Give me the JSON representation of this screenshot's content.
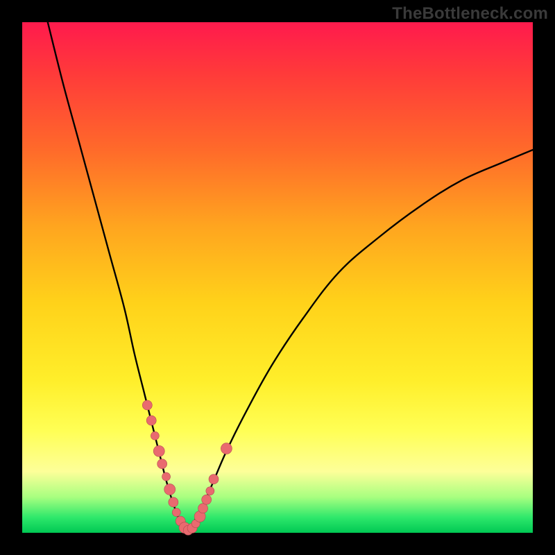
{
  "watermark": "TheBottleneck.com",
  "colors": {
    "frame": "#000000",
    "curve": "#000000",
    "marker_fill": "#e96a6f",
    "marker_stroke": "#b24a50"
  },
  "chart_data": {
    "type": "line",
    "title": "",
    "xlabel": "",
    "ylabel": "",
    "xlim": [
      0,
      100
    ],
    "ylim": [
      0,
      100
    ],
    "grid": false,
    "series": [
      {
        "name": "left-branch",
        "x": [
          5,
          8,
          11,
          14,
          17,
          20,
          22,
          24,
          25.5,
          27,
          28,
          29,
          30,
          31,
          32
        ],
        "y": [
          100,
          88,
          77,
          66,
          55,
          44,
          35,
          27,
          21,
          15,
          11,
          7.5,
          4.5,
          2,
          0.2
        ]
      },
      {
        "name": "right-branch",
        "x": [
          32,
          33.5,
          35,
          37,
          40,
          44,
          49,
          55,
          62,
          70,
          78,
          86,
          94,
          100
        ],
        "y": [
          0.2,
          2,
          4.5,
          9,
          16,
          24,
          33,
          42,
          51,
          58,
          64,
          69,
          72.5,
          75
        ]
      }
    ],
    "markers": {
      "name": "data-points",
      "x": [
        24.5,
        25.3,
        26.0,
        26.8,
        27.4,
        28.2,
        28.9,
        29.6,
        30.2,
        31.0,
        31.8,
        32.5,
        33.3,
        34.0,
        34.8,
        35.4,
        36.1,
        36.8,
        37.5,
        40.0
      ],
      "y": [
        25.0,
        22.0,
        19.0,
        16.0,
        13.5,
        11.0,
        8.5,
        6.0,
        4.0,
        2.3,
        1.0,
        0.5,
        0.9,
        1.8,
        3.2,
        4.8,
        6.5,
        8.2,
        10.5,
        16.5
      ],
      "r": [
        7,
        7,
        6,
        8,
        7,
        6,
        8,
        7,
        6,
        7,
        8,
        7,
        7,
        6,
        8,
        7,
        7,
        6,
        7,
        8
      ]
    }
  }
}
